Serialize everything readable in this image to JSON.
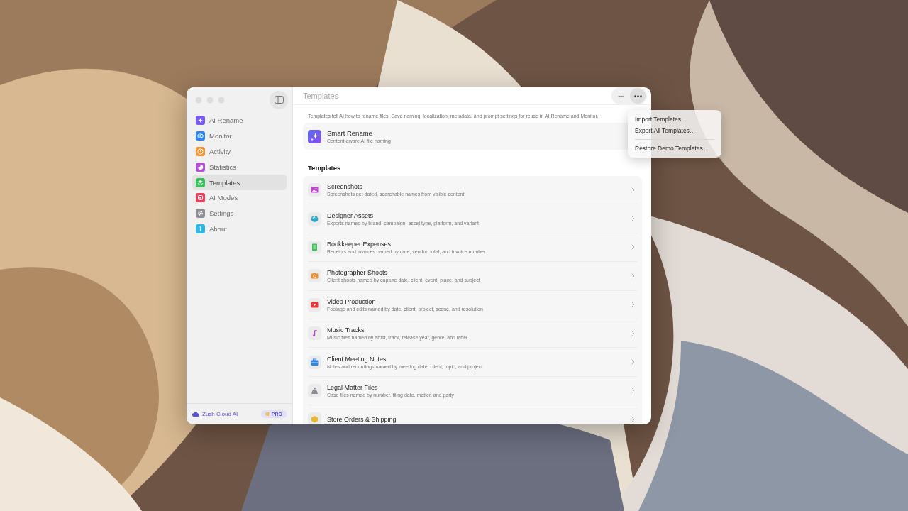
{
  "window": {
    "title": "Templates"
  },
  "sidebar": {
    "items": [
      {
        "label": "AI Rename",
        "color": "#7b5cf0",
        "selected": false
      },
      {
        "label": "Monitor",
        "color": "#2f86f6",
        "selected": false
      },
      {
        "label": "Activity",
        "color": "#f59433",
        "selected": false
      },
      {
        "label": "Statistics",
        "color": "#b34fd6",
        "selected": false
      },
      {
        "label": "Templates",
        "color": "#37c35a",
        "selected": true
      },
      {
        "label": "AI Modes",
        "color": "#ef3d5e",
        "selected": false
      },
      {
        "label": "Settings",
        "color": "#8e8e93",
        "selected": false
      },
      {
        "label": "About",
        "color": "#30b8e8",
        "selected": false
      }
    ],
    "footer": {
      "service": "Zush Cloud AI",
      "badge": "PRO"
    }
  },
  "intro": "Templates tell AI how to rename files. Save naming, localization, metadata, and prompt settings for reuse in AI Rename and Monitor.",
  "featured": {
    "title": "Smart Rename",
    "subtitle": "Content-aware AI file naming"
  },
  "section_title": "Templates",
  "templates": [
    {
      "title": "Screenshots",
      "subtitle": "Screenshots get dated, searchable names from visible content",
      "color": "#c740d8"
    },
    {
      "title": "Designer Assets",
      "subtitle": "Exports named by brand, campaign, asset type, platform, and variant",
      "color": "#2aa7c4"
    },
    {
      "title": "Bookkeeper Expenses",
      "subtitle": "Receipts and invoices named by date, vendor, total, and invoice number",
      "color": "#3cc05a"
    },
    {
      "title": "Photographer Shoots",
      "subtitle": "Client shoots named by capture date, client, event, place, and subject",
      "color": "#f08a2c"
    },
    {
      "title": "Video Production",
      "subtitle": "Footage and edits named by date, client, project, scene, and resolution",
      "color": "#ee3535"
    },
    {
      "title": "Music Tracks",
      "subtitle": "Music files named by artist, track, release year, genre, and label",
      "color": "#b83fd0"
    },
    {
      "title": "Client Meeting Notes",
      "subtitle": "Notes and recordings named by meeting date, client, topic, and project",
      "color": "#2a86e8"
    },
    {
      "title": "Legal Matter Files",
      "subtitle": "Case files named by number, filing date, matter, and party",
      "color": "#8a8a8e"
    },
    {
      "title": "Store Orders & Shipping",
      "color": "#e8b830"
    }
  ],
  "menu": {
    "groups": [
      [
        "Import Templates…",
        "Export All Templates…"
      ],
      [
        "Restore Demo Templates…"
      ]
    ]
  }
}
